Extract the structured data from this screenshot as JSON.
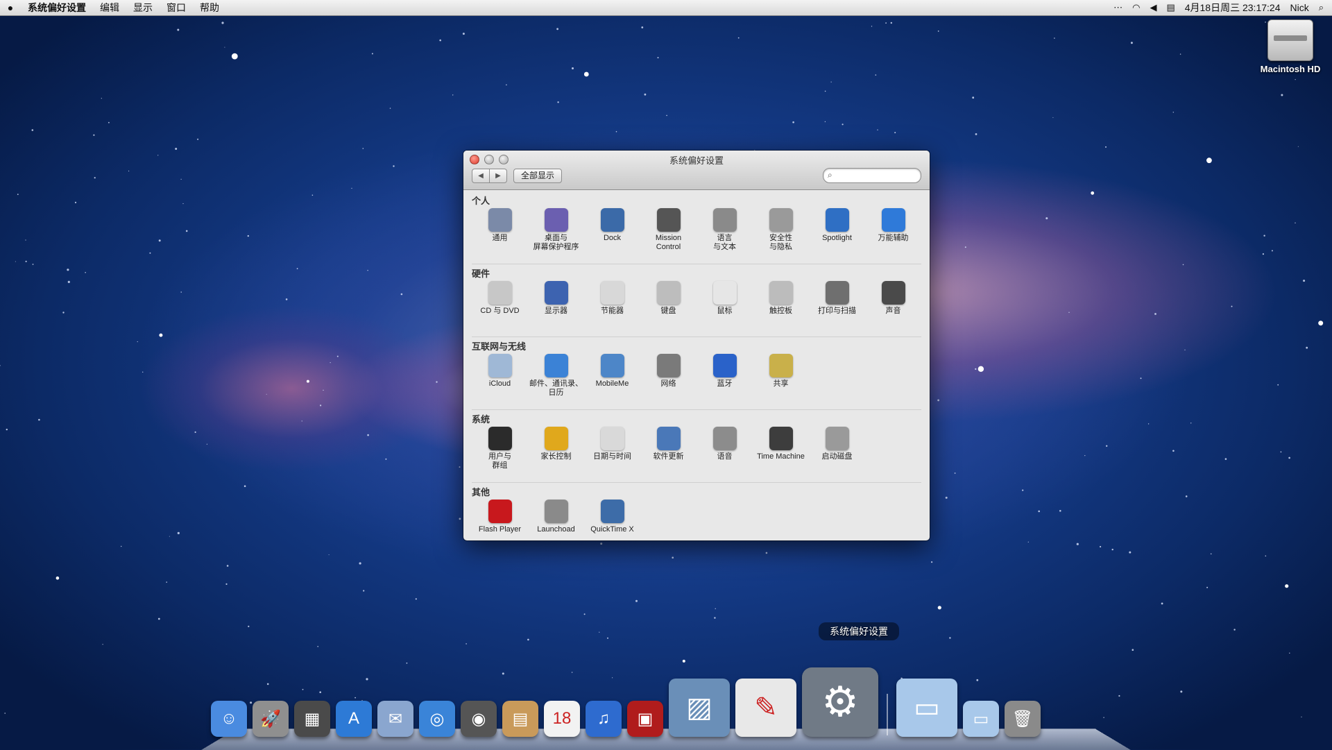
{
  "menubar": {
    "app_name": "系统偏好设置",
    "menus": [
      "编辑",
      "显示",
      "窗口",
      "帮助"
    ],
    "datetime": "4月18日周三  23:17:24",
    "user": "Nick"
  },
  "desktop": {
    "disk_label": "Macintosh HD"
  },
  "window": {
    "title": "系统偏好设置",
    "show_all": "全部显示",
    "search_placeholder": ""
  },
  "sections": [
    {
      "title": "个人",
      "items": [
        {
          "label": "通用",
          "icon": "general-icon",
          "color": "#7b8aa8"
        },
        {
          "label": "桌面与\n屏幕保护程序",
          "icon": "desktop-screensaver-icon",
          "color": "#6b5fb0"
        },
        {
          "label": "Dock",
          "icon": "dock-icon",
          "color": "#3b6aa8"
        },
        {
          "label": "Mission\nControl",
          "icon": "mission-control-icon",
          "color": "#555555"
        },
        {
          "label": "语言\n与文本",
          "icon": "language-text-icon",
          "color": "#8a8a8a"
        },
        {
          "label": "安全性\n与隐私",
          "icon": "security-privacy-icon",
          "color": "#9a9a9a"
        },
        {
          "label": "Spotlight",
          "icon": "spotlight-icon",
          "color": "#2f6fc4"
        },
        {
          "label": "万能辅助",
          "icon": "universal-access-icon",
          "color": "#2f7ad9"
        }
      ]
    },
    {
      "title": "硬件",
      "items": [
        {
          "label": "CD 与 DVD",
          "icon": "cd-dvd-icon",
          "color": "#c7c7c7"
        },
        {
          "label": "显示器",
          "icon": "displays-icon",
          "color": "#3d63b0"
        },
        {
          "label": "节能器",
          "icon": "energy-saver-icon",
          "color": "#d8d8d8"
        },
        {
          "label": "键盘",
          "icon": "keyboard-icon",
          "color": "#bdbdbd"
        },
        {
          "label": "鼠标",
          "icon": "mouse-icon",
          "color": "#e6e6e6"
        },
        {
          "label": "触控板",
          "icon": "trackpad-icon",
          "color": "#bcbcbc"
        },
        {
          "label": "打印与扫描",
          "icon": "print-scan-icon",
          "color": "#6f6f6f"
        },
        {
          "label": "声音",
          "icon": "sound-icon",
          "color": "#4a4a4a"
        }
      ]
    },
    {
      "title": "互联网与无线",
      "items": [
        {
          "label": "iCloud",
          "icon": "icloud-icon",
          "color": "#9fb8d6"
        },
        {
          "label": "邮件、通讯录、\n日历",
          "icon": "mail-contacts-calendars-icon",
          "color": "#3b82d6"
        },
        {
          "label": "MobileMe",
          "icon": "mobileme-icon",
          "color": "#4d86c8"
        },
        {
          "label": "网络",
          "icon": "network-icon",
          "color": "#7a7a7a"
        },
        {
          "label": "蓝牙",
          "icon": "bluetooth-icon",
          "color": "#2a62c9"
        },
        {
          "label": "共享",
          "icon": "sharing-icon",
          "color": "#c9b04a"
        }
      ]
    },
    {
      "title": "系统",
      "items": [
        {
          "label": "用户与\n群组",
          "icon": "users-groups-icon",
          "color": "#2b2b2b"
        },
        {
          "label": "家长控制",
          "icon": "parental-controls-icon",
          "color": "#e0a81c"
        },
        {
          "label": "日期与时间",
          "icon": "date-time-icon",
          "color": "#d9d9d9"
        },
        {
          "label": "软件更新",
          "icon": "software-update-icon",
          "color": "#4a78b8"
        },
        {
          "label": "语音",
          "icon": "speech-icon",
          "color": "#8c8c8c"
        },
        {
          "label": "Time Machine",
          "icon": "time-machine-icon",
          "color": "#3d3d3d"
        },
        {
          "label": "启动磁盘",
          "icon": "startup-disk-icon",
          "color": "#9a9a9a"
        }
      ]
    },
    {
      "title": "其他",
      "items": [
        {
          "label": "Flash Player",
          "icon": "flash-player-icon",
          "color": "#c8181d"
        },
        {
          "label": "Launchoad",
          "icon": "launchoad-icon",
          "color": "#8a8a8a"
        },
        {
          "label": "QuickTime X",
          "icon": "quicktime-icon",
          "color": "#3d6ca8"
        }
      ]
    }
  ],
  "dock": {
    "tooltip": "系统偏好设置",
    "apps": [
      {
        "icon": "finder-icon",
        "color": "#4a8be0",
        "glyph": "☺"
      },
      {
        "icon": "launchpad-icon",
        "color": "#8f8f8f",
        "glyph": "🚀"
      },
      {
        "icon": "mission-control-dock-icon",
        "color": "#4a4a4a",
        "glyph": "▦"
      },
      {
        "icon": "app-store-icon",
        "color": "#2d7ad6",
        "glyph": "A"
      },
      {
        "icon": "mail-dock-icon",
        "color": "#8aa6cf",
        "glyph": "✉"
      },
      {
        "icon": "safari-icon",
        "color": "#3a84d8",
        "glyph": "◎"
      },
      {
        "icon": "facetime-icon",
        "color": "#555555",
        "glyph": "◉"
      },
      {
        "icon": "contacts-icon",
        "color": "#c99a5a",
        "glyph": "▤"
      },
      {
        "icon": "calendar-icon",
        "color": "#f2f2f2",
        "glyph": "18"
      },
      {
        "icon": "itunes-icon",
        "color": "#2e6bcf",
        "glyph": "♫"
      },
      {
        "icon": "photo-booth-icon",
        "color": "#b01c1c",
        "glyph": "▣"
      },
      {
        "icon": "iphoto-icon",
        "color": "#6a8fb8",
        "glyph": "▨"
      },
      {
        "icon": "textedit-icon",
        "color": "#e8e8e8",
        "glyph": "✎"
      },
      {
        "icon": "system-preferences-dock-icon",
        "color": "#707a86",
        "glyph": "⚙"
      }
    ],
    "folders": [
      {
        "icon": "applications-folder-icon",
        "color": "#a8c8ea",
        "glyph": "▭"
      },
      {
        "icon": "documents-folder-icon",
        "color": "#a8c8ea",
        "glyph": "▭"
      },
      {
        "icon": "trash-icon",
        "color": "#8a8a8a",
        "glyph": "🗑"
      }
    ]
  }
}
